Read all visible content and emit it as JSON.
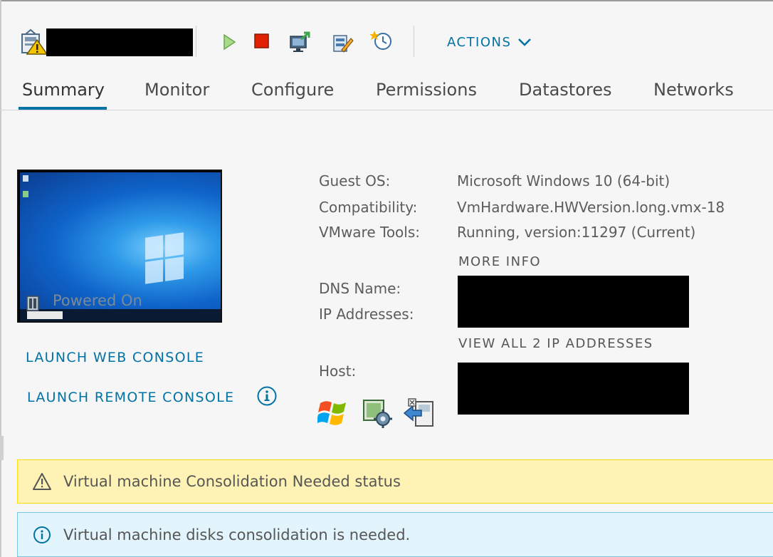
{
  "header": {
    "actions_label": "ACTIONS",
    "toolbar_icons": [
      "vm-warning-icon",
      "power-on-icon",
      "power-off-icon",
      "launch-console-icon",
      "edit-settings-icon",
      "snapshot-icon",
      "chevron-down-icon"
    ]
  },
  "tabs": [
    {
      "label": "Summary",
      "active": true
    },
    {
      "label": "Monitor"
    },
    {
      "label": "Configure"
    },
    {
      "label": "Permissions"
    },
    {
      "label": "Datastores"
    },
    {
      "label": "Networks"
    }
  ],
  "console": {
    "power_state": "Powered On",
    "launch_web": "LAUNCH WEB CONSOLE",
    "launch_remote": "LAUNCH REMOTE CONSOLE"
  },
  "details": {
    "guest_os_label": "Guest OS:",
    "guest_os_value": "Microsoft Windows 10 (64-bit)",
    "compat_label": "Compatibility:",
    "compat_value": "VmHardware.HWVersion.long.vmx-18",
    "tools_label": "VMware Tools:",
    "tools_value": "Running, version:11297 (Current)",
    "more_info": "MORE INFO",
    "dns_label": "DNS Name:",
    "ip_label": "IP Addresses:",
    "view_all_ip": "VIEW ALL 2 IP ADDRESSES",
    "host_label": "Host:",
    "host_icons": [
      "windows-flag-icon",
      "vm-settings-gear-icon",
      "migrate-vm-icon"
    ]
  },
  "banners": {
    "warning": "Virtual machine Consolidation Needed status",
    "info": "Virtual machine disks consolidation is needed."
  },
  "colors": {
    "accent": "#0072a3",
    "warning_bg": "#fef3b5",
    "info_bg": "#e3f5fc",
    "power_on": "#7bc04c",
    "power_off": "#e12200"
  }
}
